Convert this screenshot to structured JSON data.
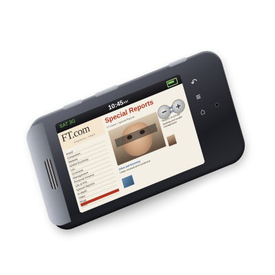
{
  "status_bar": {
    "signal_text": "SAT 3G",
    "time": "10:45",
    "ampm": "AM"
  },
  "site": {
    "logo": "FT.com",
    "logo_sub": "FINANCIAL TIMES",
    "nav_items": [
      "World",
      "Companies",
      "Markets",
      "Global Economy",
      "Lex",
      "Comment",
      "Management",
      "Personal Finance",
      "Life & Arts",
      "Special Reports",
      "In depth",
      "Video",
      "Blogs",
      "Tools"
    ],
    "section_title": "Special Reports",
    "breadcrumb": "FT Home > Special Reports",
    "sidebar_title": "FT Wealth Quarterly",
    "sidebar_body": "Reports on private banking and wealth management",
    "blurb_headline": "Cities and Economy",
    "blurb_text": "Urban renewal and investment"
  },
  "controls": {
    "zoom_out": "−",
    "zoom_in": "+"
  },
  "softkeys": {
    "back": "↶",
    "menu": "≡",
    "home": "⌂"
  },
  "colors": {
    "ft_red": "#b0331f",
    "ft_pink": "#f4e6cf",
    "link_blue": "#1d4f9a"
  }
}
